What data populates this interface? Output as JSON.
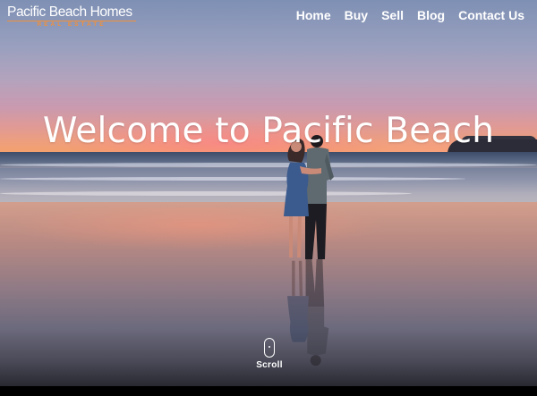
{
  "brand": {
    "name": "Pacific Beach Homes",
    "tagline": "REAL ESTATE",
    "accent_color": "#f0903c"
  },
  "nav": {
    "items": [
      {
        "label": "Home"
      },
      {
        "label": "Buy"
      },
      {
        "label": "Sell"
      },
      {
        "label": "Blog"
      },
      {
        "label": "Contact Us"
      }
    ]
  },
  "hero": {
    "title": "Welcome to Pacific Beach",
    "scroll_label": "Scroll",
    "scroll_icon": "mouse-scroll-icon"
  }
}
